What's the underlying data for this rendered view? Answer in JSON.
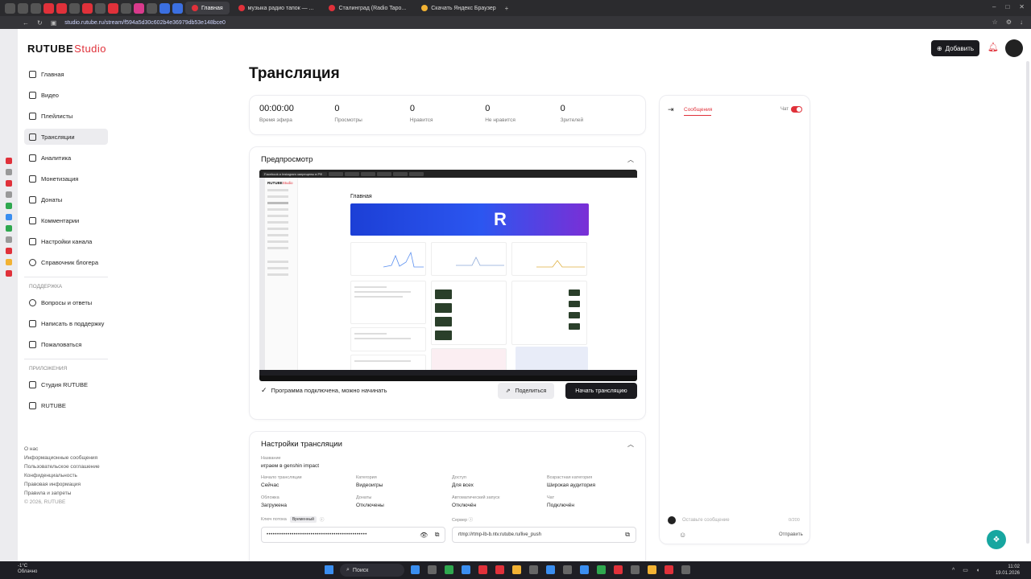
{
  "browser": {
    "tabs": [
      "Главная",
      "музыка радио тапок — ...",
      "Сталинград (Radio Tapo...",
      "Скачать Яндекс Браузер"
    ],
    "url": "studio.rutube.ru/stream/f594a5d30c602b4e36979db53e148bce0"
  },
  "header": {
    "logo_main": "RUTUBE",
    "logo_studio": "Studio",
    "add_label": "Добавить"
  },
  "sidebar": {
    "items": [
      {
        "label": "Главная",
        "icon": "home-icon"
      },
      {
        "label": "Видео",
        "icon": "video-icon"
      },
      {
        "label": "Плейлисты",
        "icon": "playlist-icon"
      },
      {
        "label": "Трансляции",
        "icon": "broadcast-icon"
      },
      {
        "label": "Аналитика",
        "icon": "analytics-icon"
      },
      {
        "label": "Монетизация",
        "icon": "monetization-icon"
      },
      {
        "label": "Донаты",
        "icon": "donate-icon"
      },
      {
        "label": "Комментарии",
        "icon": "comments-icon"
      },
      {
        "label": "Настройки канала",
        "icon": "settings-icon"
      },
      {
        "label": "Справочник блогера",
        "icon": "info-icon"
      }
    ],
    "support_title": "ПОДДЕРЖКА",
    "support_items": [
      "Вопросы и ответы",
      "Написать в поддержку",
      "Пожаловаться"
    ],
    "apps_title": "ПРИЛОЖЕНИЯ",
    "apps_items": [
      "Студия RUTUBE",
      "RUTUBE"
    ]
  },
  "footer": {
    "links": [
      "О нас",
      "Информационные сообщения",
      "Пользовательское соглашение",
      "Конфиденциальность",
      "Правовая информация",
      "Правила и запреты"
    ],
    "copyright": "© 2026, RUTUBE"
  },
  "page": {
    "title": "Трансляция"
  },
  "stats": [
    {
      "value": "00:00:00",
      "label": "Время эфира"
    },
    {
      "value": "0",
      "label": "Просмотры"
    },
    {
      "value": "0",
      "label": "Нравится"
    },
    {
      "value": "0",
      "label": "Не нравится"
    },
    {
      "value": "0",
      "label": "Зрителей"
    }
  ],
  "preview": {
    "title": "Предпросмотр",
    "inner_banner": "Facebook и Instagram запрещены в РФ",
    "inner_logo_main": "RUTUBE",
    "inner_logo_studio": "Studio",
    "inner_title": "Главная",
    "status": "Программа подключена, можно начинать",
    "share_label": "Поделиться",
    "start_label": "Начать трансляцию"
  },
  "settings": {
    "title": "Настройки трансляции",
    "name_label": "Название",
    "name_value": "играем в genshin impact",
    "fields": [
      {
        "label": "Начало трансляции",
        "value": "Сейчас"
      },
      {
        "label": "Категория",
        "value": "Видеоигры"
      },
      {
        "label": "Доступ",
        "value": "Для всех"
      },
      {
        "label": "Возрастная категория",
        "value": "Широкая аудитория"
      },
      {
        "label": "Обложка",
        "value": "Загружена"
      },
      {
        "label": "Донаты",
        "value": "Отключены"
      },
      {
        "label": "Автоматический запуск",
        "value": "Отключён"
      },
      {
        "label": "Чат",
        "value": "Подключён"
      }
    ],
    "key_label": "Ключ потока",
    "key_badge": "Временный",
    "key_value": "••••••••••••••••••••••••••••••••••••••••••••••••",
    "server_label": "Сервер",
    "server_value": "rtmp://rtmp-lb-b.ntv.rutube.ru/live_push"
  },
  "chat": {
    "tab_label": "Сообщения",
    "toggle_label": "Чат",
    "input_placeholder": "Оставьте сообщение",
    "counter": "0/200",
    "send_label": "Отправить"
  },
  "taskbar": {
    "weather_temp": "-1°C",
    "weather_desc": "Облачно",
    "search_label": "Поиск",
    "time": "11:02",
    "date": "19.01.2026"
  },
  "colors": {
    "accent": "#e0313a",
    "dark_button": "#1b1b1f",
    "support": "#17a6a0"
  }
}
